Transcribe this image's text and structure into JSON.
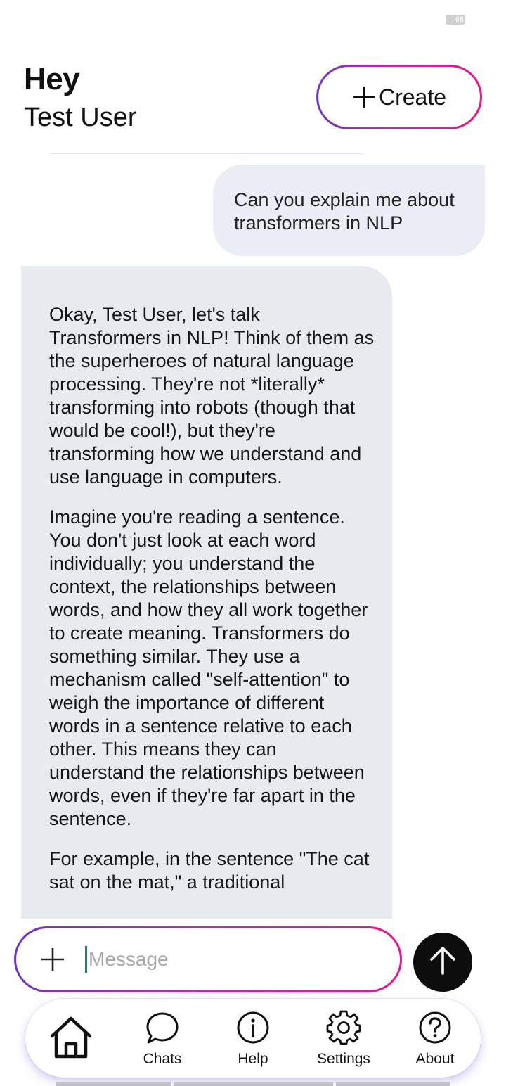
{
  "status_bar": {
    "battery": "68"
  },
  "header": {
    "greeting": "Hey",
    "user_name": "Test User",
    "create_label": "Create"
  },
  "chat": {
    "user_message": "Can you explain me about transformers in NLP",
    "ai_paragraphs": [
      "Okay, Test User, let's talk Transformers in NLP!  Think of them as the superheroes of natural language processing.  They're not *literally* transforming into robots (though that would be cool!), but they're transforming how we understand and use language in computers.",
      "Imagine you're reading a sentence. You don't just look at each word individually; you understand the context, the relationships between words, and how they all work together to create meaning. Transformers do something similar.  They use a mechanism called \"self-attention\" to weigh the importance of different words in a sentence relative to each other. This means they can understand the relationships between words, even if they're far apart in the sentence.",
      "For example, in the sentence \"The cat sat on the mat,\" a traditional"
    ]
  },
  "composer": {
    "placeholder": "Message",
    "value": ""
  },
  "nav": {
    "items": [
      {
        "label": "",
        "icon": "home-icon"
      },
      {
        "label": "Chats",
        "icon": "chat-bubble-icon"
      },
      {
        "label": "Help",
        "icon": "info-icon"
      },
      {
        "label": "Settings",
        "icon": "gear-icon"
      },
      {
        "label": "About",
        "icon": "question-icon"
      }
    ]
  },
  "colors": {
    "gradient_start": "#6e35c2",
    "gradient_end": "#e8148c",
    "user_bubble": "#eaedf5",
    "ai_bubble": "#e7eaee",
    "send_button": "#0d0d0d"
  }
}
